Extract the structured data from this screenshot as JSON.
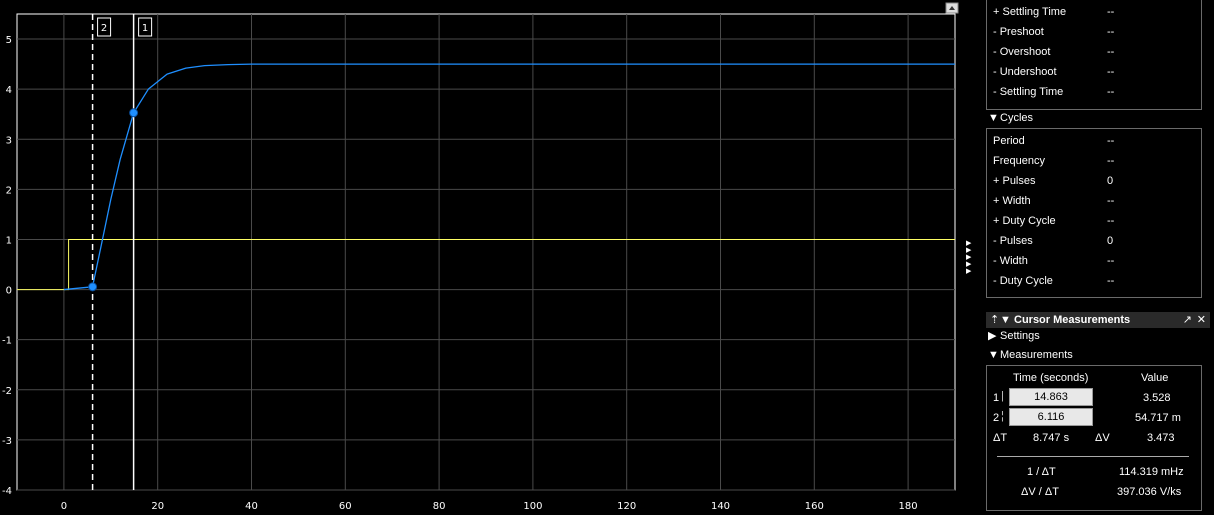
{
  "scope": {
    "x_ticks": [
      "0",
      "20",
      "40",
      "60",
      "80",
      "100",
      "120",
      "140",
      "160",
      "180"
    ],
    "y_ticks": [
      "5",
      "4",
      "3",
      "2",
      "1",
      "0",
      "-1",
      "-2",
      "-3",
      "-4"
    ],
    "cursor1_label": "1",
    "cursor2_label": "2",
    "colors": {
      "signal": "#1f8fff",
      "input": "#ffff66",
      "grid": "#4a4a4a",
      "cursor": "#ffffff"
    }
  },
  "chart_data": {
    "type": "line",
    "xlim": [
      -10,
      190
    ],
    "ylim": [
      -4,
      5.5
    ],
    "grid": true,
    "series": [
      {
        "values_desc": "",
        "x": [
          0,
          6.1,
          8,
          10,
          12,
          14.863,
          18,
          22,
          26,
          30,
          35,
          40,
          60,
          100,
          140,
          190
        ],
        "y": [
          0,
          0.055,
          0.9,
          1.8,
          2.6,
          3.528,
          4.0,
          4.3,
          4.42,
          4.47,
          4.49,
          4.5,
          4.5,
          4.5,
          4.5,
          4.5
        ]
      },
      {
        "x": [
          -10,
          1,
          1,
          190
        ],
        "y": [
          0,
          0,
          1,
          1
        ]
      }
    ],
    "cursors": [
      {
        "label": "1",
        "x": 14.863,
        "y": 3.528
      },
      {
        "label": "2",
        "x": 6.116,
        "y": 0.054717
      }
    ]
  },
  "transitions": {
    "rows": [
      {
        "label": "+ Settling Time",
        "value": "--"
      },
      {
        "label": "- Preshoot",
        "value": "--"
      },
      {
        "label": "- Overshoot",
        "value": "--"
      },
      {
        "label": "- Undershoot",
        "value": "--"
      },
      {
        "label": "- Settling Time",
        "value": "--"
      }
    ]
  },
  "cycles": {
    "title": "Cycles",
    "rows": [
      {
        "label": "Period",
        "value": "--"
      },
      {
        "label": "Frequency",
        "value": "--"
      },
      {
        "label": "+ Pulses",
        "value": "0"
      },
      {
        "label": "+ Width",
        "value": "--"
      },
      {
        "label": "+ Duty Cycle",
        "value": "--"
      },
      {
        "label": "- Pulses",
        "value": "0"
      },
      {
        "label": "- Width",
        "value": "--"
      },
      {
        "label": "- Duty Cycle",
        "value": "--"
      }
    ]
  },
  "cursor_measurements": {
    "title": "Cursor Measurements",
    "settings_label": "Settings",
    "measurements_label": "Measurements",
    "col_time": "Time (seconds)",
    "col_value": "Value",
    "c1_label": "1",
    "c1_time": "14.863",
    "c1_value": "3.528",
    "c2_label": "2",
    "c2_time": "6.116",
    "c2_value": "54.717 m",
    "dt_label": "ΔT",
    "dt_value": "8.747 s",
    "dv_label": "ΔV",
    "dv_value": "3.473",
    "inv_dt_label": "1 / ΔT",
    "inv_dt_value": "114.319 mHz",
    "dvdt_label": "ΔV / ΔT",
    "dvdt_value": "397.036 V/ks"
  }
}
